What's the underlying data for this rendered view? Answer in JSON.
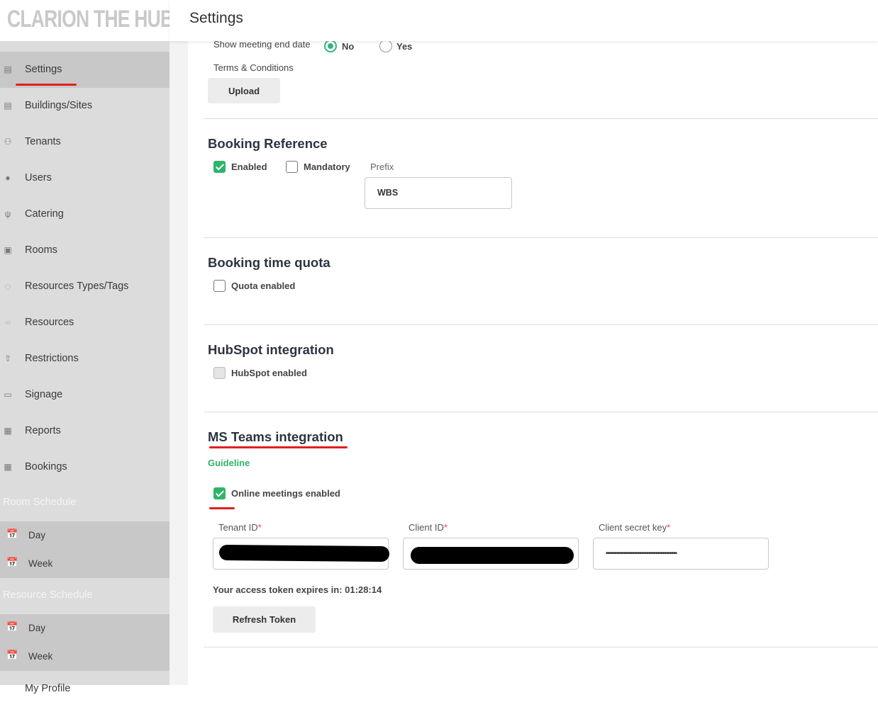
{
  "brand": "CLARION THE HUB",
  "header": {
    "title": "Settings"
  },
  "sidebar": {
    "items": [
      {
        "label": "Settings",
        "icon": "building-icon",
        "active": true
      },
      {
        "label": "Buildings/Sites",
        "icon": "building-icon"
      },
      {
        "label": "Tenants",
        "icon": "person-icon"
      },
      {
        "label": "Users",
        "icon": "users-icon"
      },
      {
        "label": "Catering",
        "icon": "cutlery-icon"
      },
      {
        "label": "Rooms",
        "icon": "room-icon"
      },
      {
        "label": "Resources Types/Tags",
        "icon": "tag-icon"
      },
      {
        "label": "Resources",
        "icon": "handshake-icon"
      },
      {
        "label": "Restrictions",
        "icon": "upload-icon"
      },
      {
        "label": "Signage",
        "icon": "monitor-icon"
      },
      {
        "label": "Reports",
        "icon": "report-icon"
      },
      {
        "label": "Bookings",
        "icon": "calendar-icon"
      }
    ],
    "room_schedule": {
      "heading": "Room Schedule",
      "items": [
        "Day",
        "Week"
      ]
    },
    "resource_schedule": {
      "heading": "Resource Schedule",
      "items": [
        "Day",
        "Week"
      ]
    },
    "cut_item": "My Profile"
  },
  "meeting_end": {
    "label": "Show meeting end date",
    "options": [
      "No",
      "Yes"
    ],
    "selected": "No"
  },
  "terms": {
    "label": "Terms & Conditions",
    "button": "Upload"
  },
  "booking_reference": {
    "heading": "Booking Reference",
    "enabled_label": "Enabled",
    "enabled": true,
    "mandatory_label": "Mandatory",
    "mandatory": false,
    "prefix_label": "Prefix",
    "prefix_value": "WBS"
  },
  "booking_time_quota": {
    "heading": "Booking time quota",
    "quota_label": "Quota enabled",
    "quota": false
  },
  "hubspot": {
    "heading": "HubSpot integration",
    "label": "HubSpot enabled",
    "enabled": false
  },
  "ms_teams": {
    "heading": "MS Teams integration",
    "guideline": "Guideline",
    "online_label": "Online meetings enabled",
    "online": true,
    "tenant_label": "Tenant ID",
    "client_label": "Client ID",
    "secret_label": "Client secret key",
    "required_mark": "*",
    "secret_value": "••••••••••••••••••••••••••••••••••••••••",
    "expires_text": "Your access token expires in: 01:28:14",
    "refresh_button": "Refresh Token"
  },
  "colors": {
    "accent": "#2db568",
    "annotation": "#e0201e",
    "sidebar_bg": "#dcdcdc"
  }
}
